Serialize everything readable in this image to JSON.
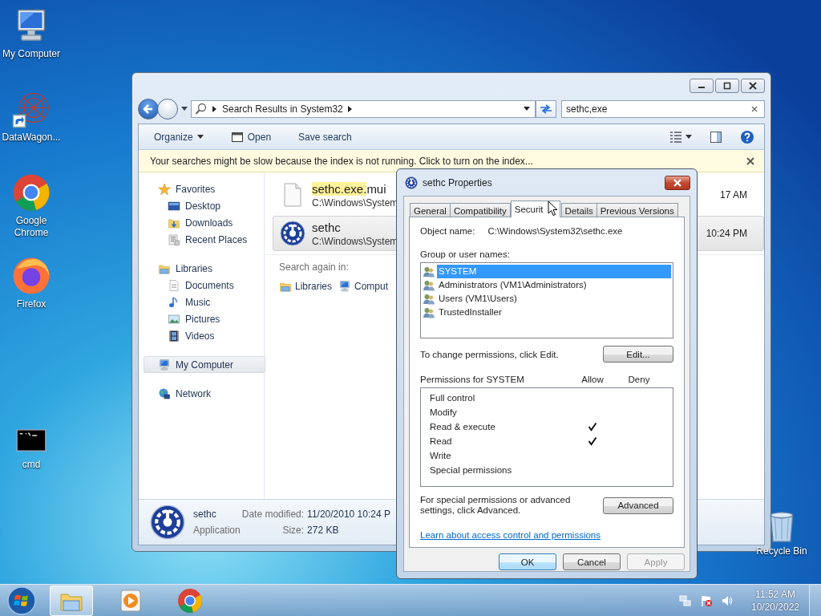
{
  "desktop_icons": [
    {
      "label": "My Computer",
      "kind": "computer"
    },
    {
      "label": "DataWagon...",
      "kind": "graph"
    },
    {
      "label": "Google Chrome",
      "kind": "chrome"
    },
    {
      "label": "Firefox",
      "kind": "firefox"
    },
    {
      "label": "cmd",
      "kind": "terminal"
    }
  ],
  "recycle_bin": {
    "label": "Recycle Bin"
  },
  "explorer": {
    "address": "Search Results in System32",
    "search_value": "sethc,exe",
    "toolbar": [
      {
        "label": "Organize",
        "kind": "menu"
      },
      {
        "label": "Open",
        "kind": "icon"
      },
      {
        "label": "Save search",
        "kind": "plain"
      }
    ],
    "info_bar": "Your searches might be slow because the index is not running.  Click to turn on the index...",
    "nav": [
      {
        "label": "Favorites",
        "kind": "star",
        "selected": false,
        "children": [
          {
            "label": "Desktop",
            "kind": "desktop",
            "selected": false
          },
          {
            "label": "Downloads",
            "kind": "downloads",
            "selected": false
          },
          {
            "label": "Recent Places",
            "kind": "recent",
            "selected": false
          }
        ]
      },
      {
        "label": "Libraries",
        "kind": "library",
        "selected": false,
        "children": [
          {
            "label": "Documents",
            "kind": "document",
            "selected": false
          },
          {
            "label": "Music",
            "kind": "music",
            "selected": false
          },
          {
            "label": "Pictures",
            "kind": "picture",
            "selected": false
          },
          {
            "label": "Videos",
            "kind": "film",
            "selected": false
          }
        ]
      },
      {
        "label": "My Computer",
        "kind": "computer",
        "selected": true
      },
      {
        "label": "Network",
        "kind": "globe",
        "selected": false
      }
    ],
    "results": [
      {
        "name_match": "sethc.exe.",
        "name_rest": "mui",
        "path": "C:\\Windows\\System",
        "time": "17 AM",
        "kind": "file",
        "selected": false
      },
      {
        "name_rest": "sethc",
        "path": "C:\\Windows\\System",
        "time": "10:24 PM",
        "kind": "app",
        "selected": true
      }
    ],
    "search_again": {
      "label": "Search again in:",
      "items": [
        {
          "label": "Libraries",
          "kind": "library"
        },
        {
          "label": "Comput",
          "kind": "computer"
        }
      ]
    },
    "details": {
      "name": "sethc",
      "type": "Application",
      "fields": [
        {
          "label": "Date modified:",
          "value": "11/20/2010 10:24 P"
        },
        {
          "label": "Size:",
          "value": "272 KB"
        }
      ]
    }
  },
  "dialog": {
    "title": "sethc Properties",
    "tabs": [
      {
        "label": "General",
        "selected": false
      },
      {
        "label": "Compatibility",
        "selected": false
      },
      {
        "label": "Securit",
        "selected": true
      },
      {
        "label": "Details",
        "selected": false
      },
      {
        "label": "Previous Versions",
        "selected": false
      }
    ],
    "object_name_label": "Object name:",
    "object_name": "C:\\Windows\\System32\\sethc.exe",
    "groups_label": "Group or user names:",
    "users": [
      {
        "name": "SYSTEM",
        "selected": true
      },
      {
        "name": "Administrators (VM1\\Administrators)",
        "selected": false
      },
      {
        "name": "Users (VM1\\Users)",
        "selected": false
      },
      {
        "name": "TrustedInstaller",
        "selected": false
      }
    ],
    "change_hint": "To change permissions, click Edit.",
    "edit_button": "Edit...",
    "permissions_label": "Permissions for SYSTEM",
    "allow_label": "Allow",
    "deny_label": "Deny",
    "permissions": [
      {
        "name": "Full control",
        "allow": false,
        "deny": false
      },
      {
        "name": "Modify",
        "allow": false,
        "deny": false
      },
      {
        "name": "Read & execute",
        "allow": true,
        "deny": false
      },
      {
        "name": "Read",
        "allow": true,
        "deny": false
      },
      {
        "name": "Write",
        "allow": false,
        "deny": false
      },
      {
        "name": "Special permissions",
        "allow": false,
        "deny": false
      }
    ],
    "advanced_hint": "For special permissions or advanced settings, click Advanced.",
    "advanced_button": "Advanced",
    "link": "Learn about access control and permissions",
    "buttons": [
      {
        "label": "OK",
        "kind": "default",
        "disabled": false
      },
      {
        "label": "Cancel",
        "kind": "normal",
        "disabled": false
      },
      {
        "label": "Apply",
        "kind": "normal",
        "disabled": true
      }
    ]
  },
  "taskbar": {
    "apps": [
      {
        "kind": "folder",
        "active": true
      },
      {
        "kind": "media",
        "active": false
      },
      {
        "kind": "chrome",
        "active": false
      }
    ],
    "time": "11:52 AM",
    "date": "10/20/2022"
  }
}
